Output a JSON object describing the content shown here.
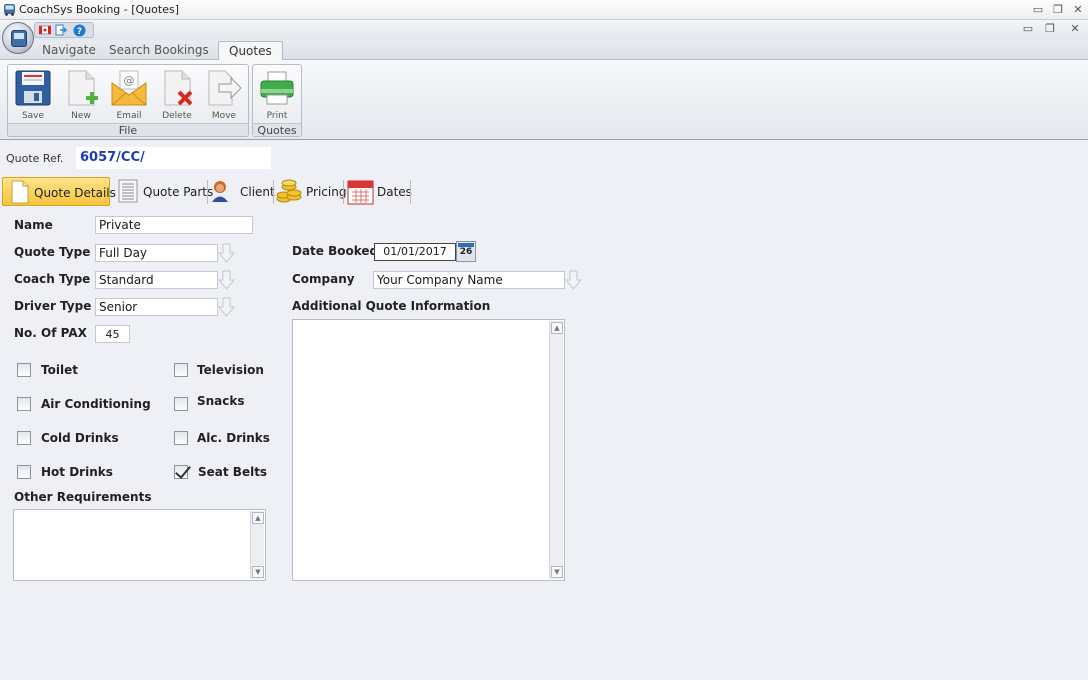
{
  "window": {
    "title": "CoachSys Booking - [Quotes]",
    "minimize_glyph": "▭",
    "restore_glyph": "❐",
    "close_glyph": "✕"
  },
  "ribbon": {
    "tabs": [
      {
        "label": "Navigate"
      },
      {
        "label": "Search Bookings"
      },
      {
        "label": "Quotes"
      }
    ],
    "groups": {
      "file": {
        "label": "File",
        "buttons": [
          {
            "label": "Save",
            "icon": "floppy-disk-icon"
          },
          {
            "label": "New",
            "icon": "new-document-icon"
          },
          {
            "label": "Email",
            "icon": "email-envelope-icon"
          },
          {
            "label": "Delete",
            "icon": "delete-document-icon"
          },
          {
            "label": "Move",
            "icon": "move-arrow-icon"
          }
        ]
      },
      "quotes": {
        "label": "Quotes",
        "buttons": [
          {
            "label": "Print",
            "icon": "printer-icon"
          }
        ]
      }
    }
  },
  "quote_ref": {
    "label": "Quote Ref.",
    "value": "6057/CC/"
  },
  "subtabs": [
    {
      "label": "Quote Details",
      "icon": "document-icon",
      "active": true
    },
    {
      "label": "Quote Parts",
      "icon": "list-icon"
    },
    {
      "label": "Client",
      "icon": "person-icon"
    },
    {
      "label": "Pricing",
      "icon": "coins-icon"
    },
    {
      "label": "Dates",
      "icon": "calendar-icon"
    }
  ],
  "form": {
    "name": {
      "label": "Name",
      "value": "Private"
    },
    "quote_type": {
      "label": "Quote Type",
      "value": "Full Day"
    },
    "coach_type": {
      "label": "Coach Type",
      "value": "Standard"
    },
    "driver_type": {
      "label": "Driver Type",
      "value": "Senior"
    },
    "pax": {
      "label": "No. Of PAX",
      "value": "45"
    },
    "date_booked": {
      "label": "Date Booked",
      "value": "01/01/2017",
      "calendar_day": "26"
    },
    "company": {
      "label": "Company",
      "value": "Your Company Name"
    },
    "additional_info": {
      "label": "Additional Quote Information",
      "value": ""
    },
    "other_requirements": {
      "label": "Other Requirements",
      "value": ""
    }
  },
  "amenities": [
    {
      "label": "Toilet",
      "checked": false
    },
    {
      "label": "Television",
      "checked": false
    },
    {
      "label": "Air Conditioning",
      "checked": false
    },
    {
      "label": "Snacks",
      "checked": false
    },
    {
      "label": "Cold Drinks",
      "checked": false
    },
    {
      "label": "Alc. Drinks",
      "checked": false
    },
    {
      "label": "Hot Drinks",
      "checked": false
    },
    {
      "label": "Seat Belts",
      "checked": true
    }
  ],
  "scroll": {
    "up": "▲",
    "down": "▼"
  }
}
